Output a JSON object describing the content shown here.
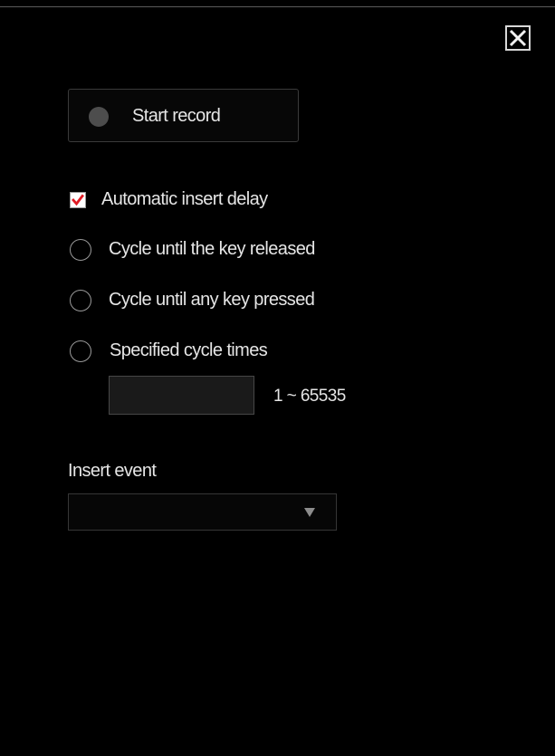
{
  "record": {
    "label": "Start record"
  },
  "options": {
    "auto_delay": {
      "label": "Automatic insert delay",
      "checked": true
    },
    "cycle_release": {
      "label": "Cycle until the key released",
      "selected": false
    },
    "cycle_any_key": {
      "label": "Cycle until any key pressed",
      "selected": false
    },
    "specified_cycles": {
      "label": "Specified cycle times",
      "selected": false
    }
  },
  "cycle_times": {
    "value": "",
    "range": "1 ~ 65535"
  },
  "insert_event": {
    "label": "Insert event",
    "value": ""
  },
  "colors": {
    "background": "#000000",
    "text": "#e6e6e6",
    "check_accent": "#e01b24",
    "record_dot": "#4d4d4d",
    "border": "#3a3a3a"
  },
  "icons": {
    "close": "close-icon",
    "record": "record-dot-icon",
    "dropdown": "triangle-down-icon"
  }
}
